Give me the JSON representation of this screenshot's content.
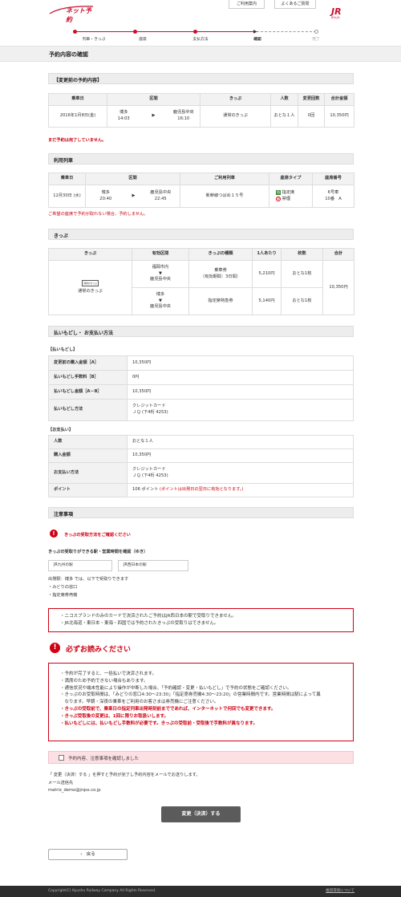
{
  "header": {
    "logo_text": "ネット予約",
    "help_label": "ご利用案内",
    "faq_label": "よくあるご質問",
    "jr_label": "JR",
    "jr_sub": "JR九州"
  },
  "steps": [
    "列車・きっぷ",
    "座席",
    "支払方法",
    "確認",
    "完了"
  ],
  "page_title": "予約内容の確認",
  "before": {
    "section": "【変更前の予約内容】",
    "headers": [
      "乗車日",
      "区間",
      "きっぷ",
      "人数",
      "変更回数",
      "合計金額"
    ],
    "row": {
      "date": "2016年1月8日(金)",
      "from": "博多",
      "dep": "14:03",
      "to": "鹿児島中央",
      "arr": "16:10",
      "ticket": "通常のきっぷ",
      "people": "おとな１人",
      "changes": "0回",
      "total": "10,350円"
    },
    "note": "まだ予約は完了していません。"
  },
  "train": {
    "section": "利用列車",
    "headers": [
      "乗車日",
      "区間",
      "ご利用列車",
      "座席タイプ",
      "座席番号"
    ],
    "row": {
      "date": "12月30日 (水)",
      "from": "博多",
      "dep": "20:40",
      "to": "鹿児島中央",
      "arr": "22:45",
      "train": "新幹線つばめ１５号",
      "seat_type": "指定席",
      "smoking": "禁煙",
      "car": "6号車",
      "seat": "10番　A"
    },
    "note": "ご希望の座席で予約が取れない場合、予約しません。"
  },
  "kippu": {
    "section": "きっぷ",
    "headers": [
      "きっぷ",
      "有効区間",
      "きっぷの種類",
      "1人あたり",
      "枚数",
      "合計"
    ],
    "ticket_name": "通常のきっぷ",
    "ticket_tag": "通常のきっぷ",
    "rows": [
      {
        "from": "福岡市内",
        "to": "鹿児島中央",
        "type": "乗車券",
        "validity": "（有効期間：3日間）",
        "price": "5,210円",
        "qty": "おとな1枚"
      },
      {
        "from": "博多",
        "to": "鹿児島中央",
        "type": "指定席特急券",
        "validity": "",
        "price": "5,140円",
        "qty": "おとな1枚"
      }
    ],
    "total": "10,350円"
  },
  "payment": {
    "section": "払いもどし・ お支払い方法",
    "refund_title": "【払いもどし】",
    "refund": [
      {
        "k": "変更前の購入金額［A］",
        "v": "10,350円"
      },
      {
        "k": "払いもどし手数料［B］",
        "v": "0円"
      },
      {
        "k": "払いもどし金額［A－B］",
        "v": "10,350円"
      }
    ],
    "refund_method_k": "払いもどし方法",
    "refund_method_v1": "クレジットカード",
    "refund_method_v2": "ＪＱ (下4桁 4253)",
    "pay_title": "【お支払い】",
    "people_k": "人数",
    "people_v": "おとな１人",
    "amount_k": "購入金額",
    "amount_v": "10,350円",
    "method_k": "お支払い方法",
    "method_v1": "クレジットカード",
    "method_v2": "ＪＱ (下4桁 4253)",
    "point_k": "ポイント",
    "point_v": "106 ポイント",
    "point_note": "(ポイントは出発日の翌日に有効となります。)"
  },
  "notice": {
    "section": "注意事項",
    "check_label": "きっぷの受取方法をご確認ください",
    "stations_title": "きっぷの受取りができる駅・営業時間を確認（ゆき）",
    "station1": "JR九州の駅",
    "station2": "JR西日本の駅",
    "pickup_line": "出発駅：博多 では、以下で受取りできます",
    "pickup_items": [
      "・みどりの窓口",
      "・指定席券売機"
    ],
    "box1": [
      "・ニコスブランドのみのカードで決済されたご予約はJR西日本の駅で受取りできません。",
      "・JR北海道・東日本・東海・四国では予約されたきっぷの受取りはできません。"
    ],
    "must_title": "必ずお読みください",
    "must": [
      "・予約が完了すると、一括払いで決済されます。",
      "・満席のため予約できない場合もあります。",
      "・通信状況や端末性能により操作が中断した場合、「予約確認・変更・払いもどし」で予約の状態をご確認ください。",
      "・きっぷのお受取時間は、「みどりの窓口4:30～23:30」「指定席券売機4:30～23:20」の営業時間内です。営業時間は駅によって異",
      "　なります。早朝・深夜の乗車をご利用のお客さまは券売機にご注意ください。"
    ],
    "must_red": [
      "・きっぷの受取前で、乗車日の指定列車出発時刻前までであれば、インターネットで何回でも変更できます。",
      "・きっぷ受取後の変更は、1回に限りお取扱いします。",
      "・払いもどしには、払いもどし手数料が必要です。きっぷの受取前・受取後で手数料が異なります。"
    ],
    "agree": "予約内容、注意事項を確認しました"
  },
  "closing": {
    "line1": "「 変更（決済）する 」を押すと予約が完了し予約内容をメールでお送りします。",
    "mail_label": "メール送信先",
    "mail": "matrix_demo@jrqss.co.jp"
  },
  "submit_label": "変更（決済）する",
  "back_label": "戻る",
  "footer": {
    "copyright": "Copyright(C) Kyushu Railway Company All Rights Reserved.",
    "link": "推奨環境について"
  }
}
